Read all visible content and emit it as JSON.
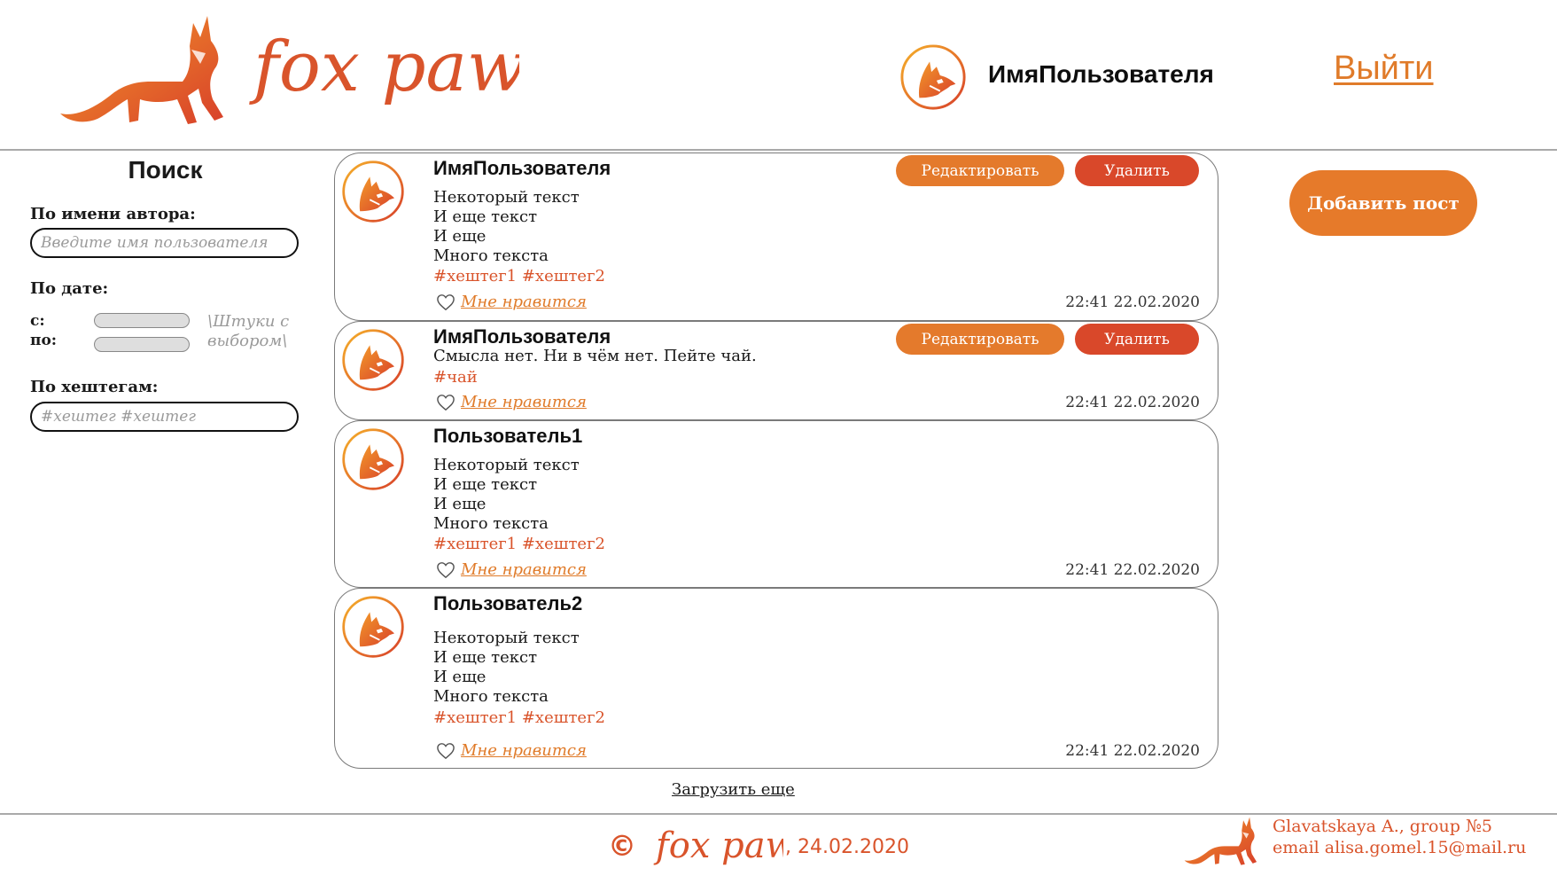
{
  "header": {
    "brand": "fox paw",
    "user_name": "ИмяПользователя",
    "logout_label": "Выйти"
  },
  "sidebar": {
    "title": "Поиск",
    "author_label": "По имени автора:",
    "author_placeholder": "Введите имя пользователя",
    "date_label": "По дате:",
    "date_from_label": "с:",
    "date_to_label": "по:",
    "date_note": "\\Штуки с выбором\\",
    "hashtags_label": "По хештегам:",
    "hashtags_placeholder": "#хештег #хештег"
  },
  "actions": {
    "add_post_label": "Добавить пост",
    "edit_label": "Редактировать",
    "delete_label": "Удалить",
    "like_label": "Мне нравится",
    "load_more_label": "Загрузить еще"
  },
  "posts": [
    {
      "author": "ИмяПользователя",
      "text": "Некоторый текст\nИ еще текст\nИ еще\nМного текста",
      "tags": "#хештег1 #хештег2",
      "date": "22:41 22.02.2020",
      "own": true
    },
    {
      "author": "ИмяПользователя",
      "text": "Смысла нет. Ни в чём нет. Пейте чай.",
      "tags": "#чай",
      "date": "22:41 22.02.2020",
      "own": true
    },
    {
      "author": "Пользователь1",
      "text": "Некоторый текст\nИ еще текст\nИ еще\nМного текста",
      "tags": "#хештег1 #хештег2",
      "date": "22:41 22.02.2020",
      "own": false
    },
    {
      "author": "Пользователь2",
      "text": "Некоторый текст\nИ еще текст\nИ еще\nМного текста",
      "tags": "#хештег1 #хештег2",
      "date": "22:41 22.02.2020",
      "own": false
    }
  ],
  "footer": {
    "copyright_symbol": "©",
    "brand": "fox paw",
    "date": ", 24.02.2020",
    "credits_line1": "Glavatskaya A., group №5",
    "credits_line2": "email  alisa.gomel.15@mail.ru"
  },
  "colors": {
    "accent_orange": "#e67a2a",
    "accent_red": "#d9482a",
    "tag_color": "#d9542b"
  },
  "icons": [
    "fox-logo-icon",
    "fox-avatar-icon",
    "heart-icon",
    "copyright-icon"
  ]
}
